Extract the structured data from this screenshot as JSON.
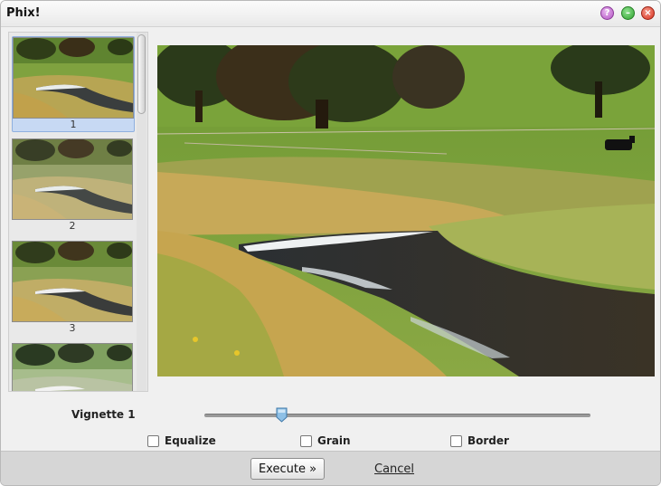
{
  "window": {
    "title": "Phix!"
  },
  "titlebar": {
    "help_glyph": "?",
    "minimize_glyph": "–",
    "close_glyph": "×"
  },
  "thumbnails": [
    {
      "label": "1",
      "selected": true
    },
    {
      "label": "2",
      "selected": false
    },
    {
      "label": "3",
      "selected": false
    },
    {
      "label": "",
      "selected": false
    }
  ],
  "controls": {
    "slider_label": "Vignette 1",
    "slider_value": 0.2,
    "checkboxes": [
      {
        "label": "Equalize",
        "checked": false
      },
      {
        "label": "Grain",
        "checked": false
      },
      {
        "label": "Border",
        "checked": false
      }
    ]
  },
  "footer": {
    "execute_label": "Execute »",
    "cancel_label": "Cancel"
  },
  "icons": {
    "help": "help-icon",
    "minimize": "minimize-icon",
    "close": "close-icon"
  },
  "colors": {
    "help": "#b454c4",
    "minimize": "#2fa22f",
    "close": "#d8301e",
    "selection": "#c7d9f3"
  }
}
